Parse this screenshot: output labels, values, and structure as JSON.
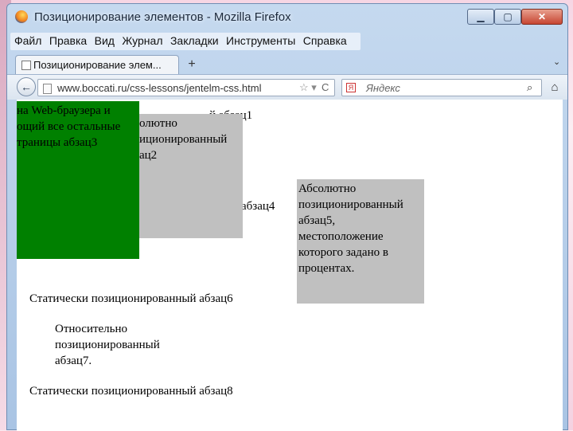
{
  "window": {
    "title": "Позиционирование элементов - Mozilla Firefox",
    "min_label": "▁",
    "max_label": "▢",
    "close_label": "✕"
  },
  "menu": [
    "Файл",
    "Правка",
    "Вид",
    "Журнал",
    "Закладки",
    "Инструменты",
    "Справка"
  ],
  "tab": {
    "label": "Позиционирование элем...",
    "new_tab": "+",
    "tab_menu": "⌄"
  },
  "nav": {
    "url": "www.boccati.ru/css-lessons/jentelm-css.html",
    "search_placeholder": "Яндекс",
    "back": "←",
    "reload": "C",
    "star": "☆ ▾",
    "search_icon": "⌕",
    "home": "⌂"
  },
  "content": {
    "abs_green_lines": [
      "на Web-браузера и",
      "ощий все остальные",
      "траницы абзац3"
    ],
    "abs_grey2_lines": [
      "олютно",
      "иционированный",
      "ац2"
    ],
    "p1": "й абзац1",
    "p4": "абзац4",
    "abs_grey5": "Абсолютно позиционированный абзац5, местоположение которого задано в процентах.",
    "p6": "Статически позиционированный абзац6",
    "p7": "Относительно позиционированный абзац7.",
    "p8": "Статически позиционированный абзац8"
  },
  "colors": {
    "green_block": "#008000",
    "grey_block": "#c0c0c0"
  }
}
